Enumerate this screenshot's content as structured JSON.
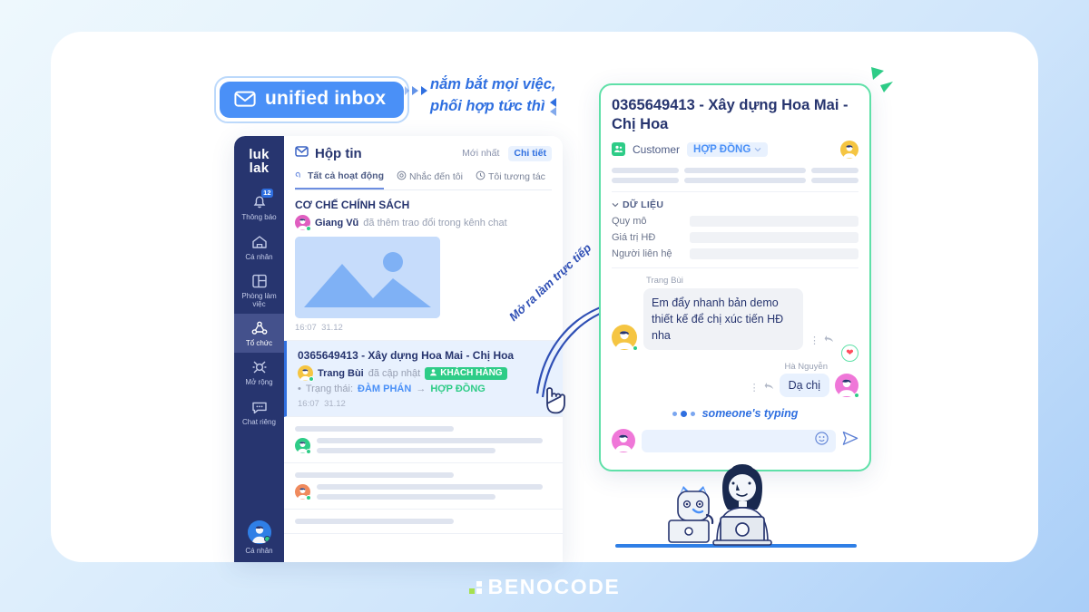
{
  "brand": {
    "name": "BENOCODE"
  },
  "banner": {
    "pill_label": "unified inbox",
    "pill_icon": "inbox-icon",
    "tagline_line1": "nắm bắt mọi việc,",
    "tagline_line2": "phối hợp tức thì"
  },
  "annotation": {
    "arrow_label": "Mở ra làm trực tiếp"
  },
  "sidebar": {
    "logo_line1": "luk",
    "logo_line2": "lak",
    "items": [
      {
        "label": "Thông báo",
        "icon": "bell-icon",
        "badge": "12",
        "active": false
      },
      {
        "label": "Cá nhân",
        "icon": "home-icon",
        "badge": "",
        "active": false
      },
      {
        "label": "Phòng làm việc",
        "icon": "workspace-icon",
        "badge": "",
        "active": false
      },
      {
        "label": "Tổ chức",
        "icon": "organization-icon",
        "badge": "",
        "active": true
      },
      {
        "label": "Mở rộng",
        "icon": "expand-icon",
        "badge": "",
        "active": false
      },
      {
        "label": "Chat riêng",
        "icon": "chat-icon",
        "badge": "",
        "active": false
      }
    ],
    "profile_label": "Cá nhân"
  },
  "inbox": {
    "title": "Hộp tin",
    "title_icon": "inbox-icon",
    "segments": [
      {
        "label": "Mới nhất",
        "active": false
      },
      {
        "label": "Chi tiết",
        "active": true
      }
    ],
    "tabs": [
      {
        "label": "Tất cả hoạt động",
        "icon": "activity-icon",
        "active": true
      },
      {
        "label": "Nhắc đến tôi",
        "icon": "mention-icon",
        "active": false
      },
      {
        "label": "Tôi tương tác",
        "icon": "clock-icon",
        "active": false
      }
    ],
    "conversations": [
      {
        "title": "CƠ CHẾ CHÍNH SÁCH",
        "author": "Giang Vũ",
        "action": "đã thêm trao đổi trong kênh chat",
        "has_image": true,
        "time": "16:07",
        "date": "31.12",
        "selected": false
      },
      {
        "title": "0365649413 - Xây dựng Hoa Mai - Chị Hoa",
        "author": "Trang Bùi",
        "action": "đã cập nhật",
        "tag": "KHÁCH HÀNG",
        "status_label": "Trạng thái:",
        "status_from": "ĐÀM PHÁN",
        "status_arrow": "→",
        "status_to": "HỢP ĐỒNG",
        "time": "16:07",
        "date": "31.12",
        "selected": true
      }
    ],
    "skeleton_rows": 3
  },
  "chat": {
    "title": "0365649413 - Xây dựng Hoa Mai - Chị Hoa",
    "customer_label": "Customer",
    "customer_icon": "customer-icon",
    "stage_chip": "HỢP ĐỒNG",
    "stage_chip_icon": "chevron-down-icon",
    "data_section": {
      "heading": "DỮ LIỆU",
      "toggle_icon": "chevron-down-icon",
      "fields": [
        {
          "label": "Quy mô",
          "value": ""
        },
        {
          "label": "Giá trị HĐ",
          "value": ""
        },
        {
          "label": "Người liên hệ",
          "value": ""
        }
      ]
    },
    "messages": [
      {
        "sender": "Trang Bùi",
        "text": "Em đẩy nhanh bản demo thiết kế để chị xúc tiến HĐ nha",
        "direction": "in",
        "reaction": "❤",
        "tools": [
          "more-icon",
          "reply-icon"
        ]
      },
      {
        "sender": "Hà Nguyễn",
        "text": "Dạ chị",
        "direction": "out",
        "tools": [
          "more-icon",
          "reply-icon"
        ]
      }
    ],
    "typing_text": "someone's typing",
    "composer": {
      "placeholder": "",
      "emoji_icon": "emoji-icon",
      "send_icon": "send-icon"
    }
  },
  "colors": {
    "brand_blue": "#2f6fe0",
    "accent_blue": "#4a90f7",
    "navy": "#27356f",
    "green": "#2ecc87",
    "mint_border": "#5fe0a8"
  }
}
